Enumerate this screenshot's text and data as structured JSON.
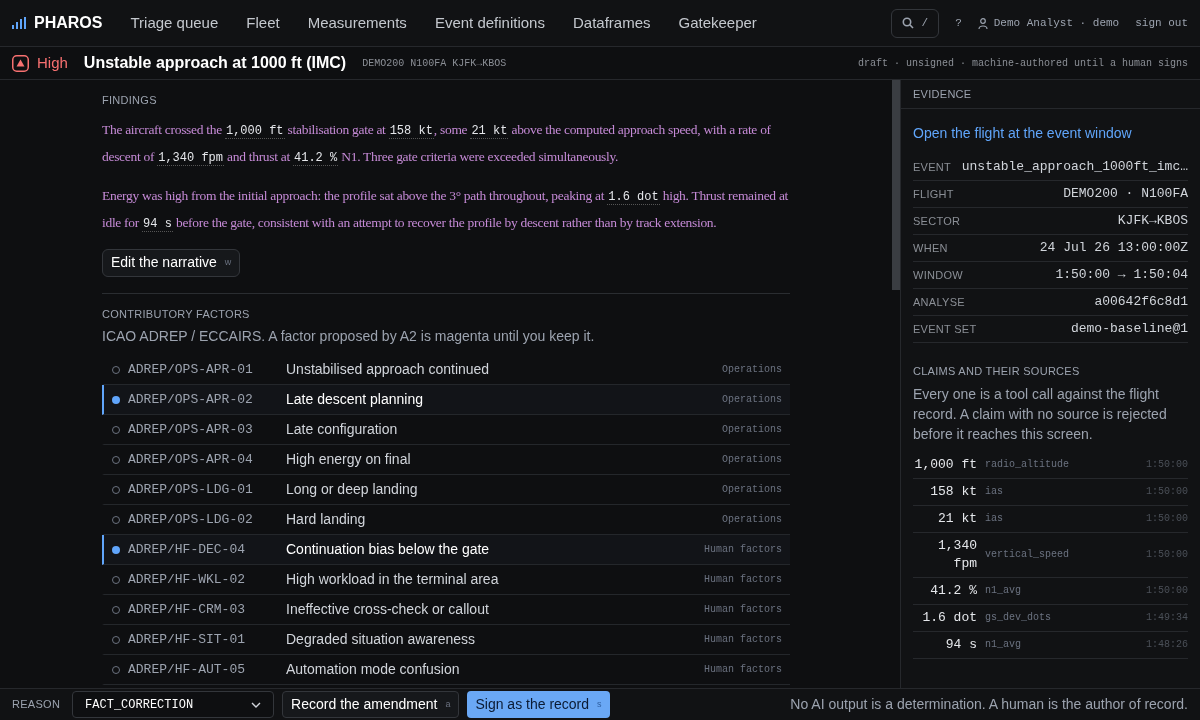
{
  "nav": {
    "brand": "PHAROS",
    "items": [
      {
        "label": "Triage queue",
        "selected": false
      },
      {
        "label": "Fleet",
        "selected": false
      },
      {
        "label": "Measurements",
        "selected": false
      },
      {
        "label": "Event definitions",
        "selected": false
      },
      {
        "label": "Dataframes",
        "selected": false
      },
      {
        "label": "Gatekeeper",
        "selected": false
      }
    ],
    "search_key": "/",
    "help": "?",
    "user": "Demo Analyst · demo",
    "sign_out": "sign out"
  },
  "header": {
    "severity": "High",
    "title": "Unstable approach at 1000 ft (IMC)",
    "ids": "DEMO200 N100FA KJFK→KBOS",
    "status": "draft · unsigned · machine-authored until a human signs"
  },
  "findings": {
    "heading": "FINDINGS",
    "paragraphs": [
      [
        {
          "kind": "text",
          "text": "The aircraft crossed the "
        },
        {
          "kind": "value",
          "text": "1,000 ft"
        },
        {
          "kind": "text",
          "text": " stabilisation gate at "
        },
        {
          "kind": "value",
          "text": "158 kt"
        },
        {
          "kind": "text",
          "text": ", some "
        },
        {
          "kind": "value",
          "text": "21 kt"
        },
        {
          "kind": "text",
          "text": " above the computed approach speed, with a rate of descent of "
        },
        {
          "kind": "value",
          "text": "1,340 fpm"
        },
        {
          "kind": "text",
          "text": " and thrust at "
        },
        {
          "kind": "value",
          "text": "41.2 %"
        },
        {
          "kind": "text",
          "text": " N1. Three gate criteria were exceeded simultaneously."
        }
      ],
      [
        {
          "kind": "text",
          "text": "Energy was high from the initial approach: the profile sat above the 3° path throughout, peaking at "
        },
        {
          "kind": "value",
          "text": "1.6 dot"
        },
        {
          "kind": "text",
          "text": " high. Thrust remained at idle for "
        },
        {
          "kind": "value",
          "text": "94 s"
        },
        {
          "kind": "text",
          "text": " before the gate, consistent with an attempt to recover the profile by descent rather than by track extension."
        }
      ]
    ],
    "edit_button": "Edit the narrative",
    "edit_key": "w"
  },
  "factors": {
    "heading": "CONTRIBUTORY FACTORS",
    "note": "ICAO ADREP / ECCAIRS. A factor proposed by A2 is magenta until you keep it.",
    "rows": [
      {
        "code": "ADREP/OPS-APR-01",
        "label": "Unstabilised approach continued",
        "category": "Operations",
        "selected": false
      },
      {
        "code": "ADREP/OPS-APR-02",
        "label": "Late descent planning",
        "category": "Operations",
        "selected": true
      },
      {
        "code": "ADREP/OPS-APR-03",
        "label": "Late configuration",
        "category": "Operations",
        "selected": false
      },
      {
        "code": "ADREP/OPS-APR-04",
        "label": "High energy on final",
        "category": "Operations",
        "selected": false
      },
      {
        "code": "ADREP/OPS-LDG-01",
        "label": "Long or deep landing",
        "category": "Operations",
        "selected": false
      },
      {
        "code": "ADREP/OPS-LDG-02",
        "label": "Hard landing",
        "category": "Operations",
        "selected": false
      },
      {
        "code": "ADREP/HF-DEC-04",
        "label": "Continuation bias below the gate",
        "category": "Human factors",
        "selected": true
      },
      {
        "code": "ADREP/HF-WKL-02",
        "label": "High workload in the terminal area",
        "category": "Human factors",
        "selected": false
      },
      {
        "code": "ADREP/HF-CRM-03",
        "label": "Ineffective cross-check or callout",
        "category": "Human factors",
        "selected": false
      },
      {
        "code": "ADREP/HF-SIT-01",
        "label": "Degraded situation awareness",
        "category": "Human factors",
        "selected": false
      },
      {
        "code": "ADREP/HF-AUT-05",
        "label": "Automation mode confusion",
        "category": "Human factors",
        "selected": false
      }
    ]
  },
  "evidence": {
    "heading": "EVIDENCE",
    "link": "Open the flight at the event window",
    "fields": [
      {
        "label": "EVENT",
        "value": "unstable_approach_1000ft_imc…"
      },
      {
        "label": "FLIGHT",
        "value": "DEMO200 · N100FA"
      },
      {
        "label": "SECTOR",
        "value": "KJFK→KBOS"
      },
      {
        "label": "WHEN",
        "value": "24 Jul 26 13:00:00Z"
      },
      {
        "label": "WINDOW",
        "value": "1:50:00 → 1:50:04"
      },
      {
        "label": "ANALYSE",
        "value": "a00642f6c8d1"
      },
      {
        "label": "EVENT SET",
        "value": "demo-baseline@1"
      }
    ],
    "claims_heading": "CLAIMS AND THEIR SOURCES",
    "claims_note": "Every one is a tool call against the flight record. A claim with no source is rejected before it reaches this screen.",
    "claims": [
      {
        "value": "1,000 ft",
        "source": "radio_altitude",
        "time": "1:50:00"
      },
      {
        "value": "158 kt",
        "source": "ias",
        "time": "1:50:00"
      },
      {
        "value": "21 kt",
        "source": "ias",
        "time": "1:50:00"
      },
      {
        "value": "1,340 fpm",
        "source": "vertical_speed",
        "time": "1:50:00"
      },
      {
        "value": "41.2 %",
        "source": "n1_avg",
        "time": "1:50:00"
      },
      {
        "value": "1.6 dot",
        "source": "gs_dev_dots",
        "time": "1:49:34"
      },
      {
        "value": "94 s",
        "source": "n1_avg",
        "time": "1:48:26"
      }
    ]
  },
  "footer": {
    "reason_label": "REASON",
    "reason_value": "FACT_CORRECTION",
    "record_button": "Record the amendment",
    "record_key": "a",
    "sign_button": "Sign as the record",
    "sign_key": "s",
    "disclaimer": "No AI output is a determination. A human is the author of record."
  }
}
